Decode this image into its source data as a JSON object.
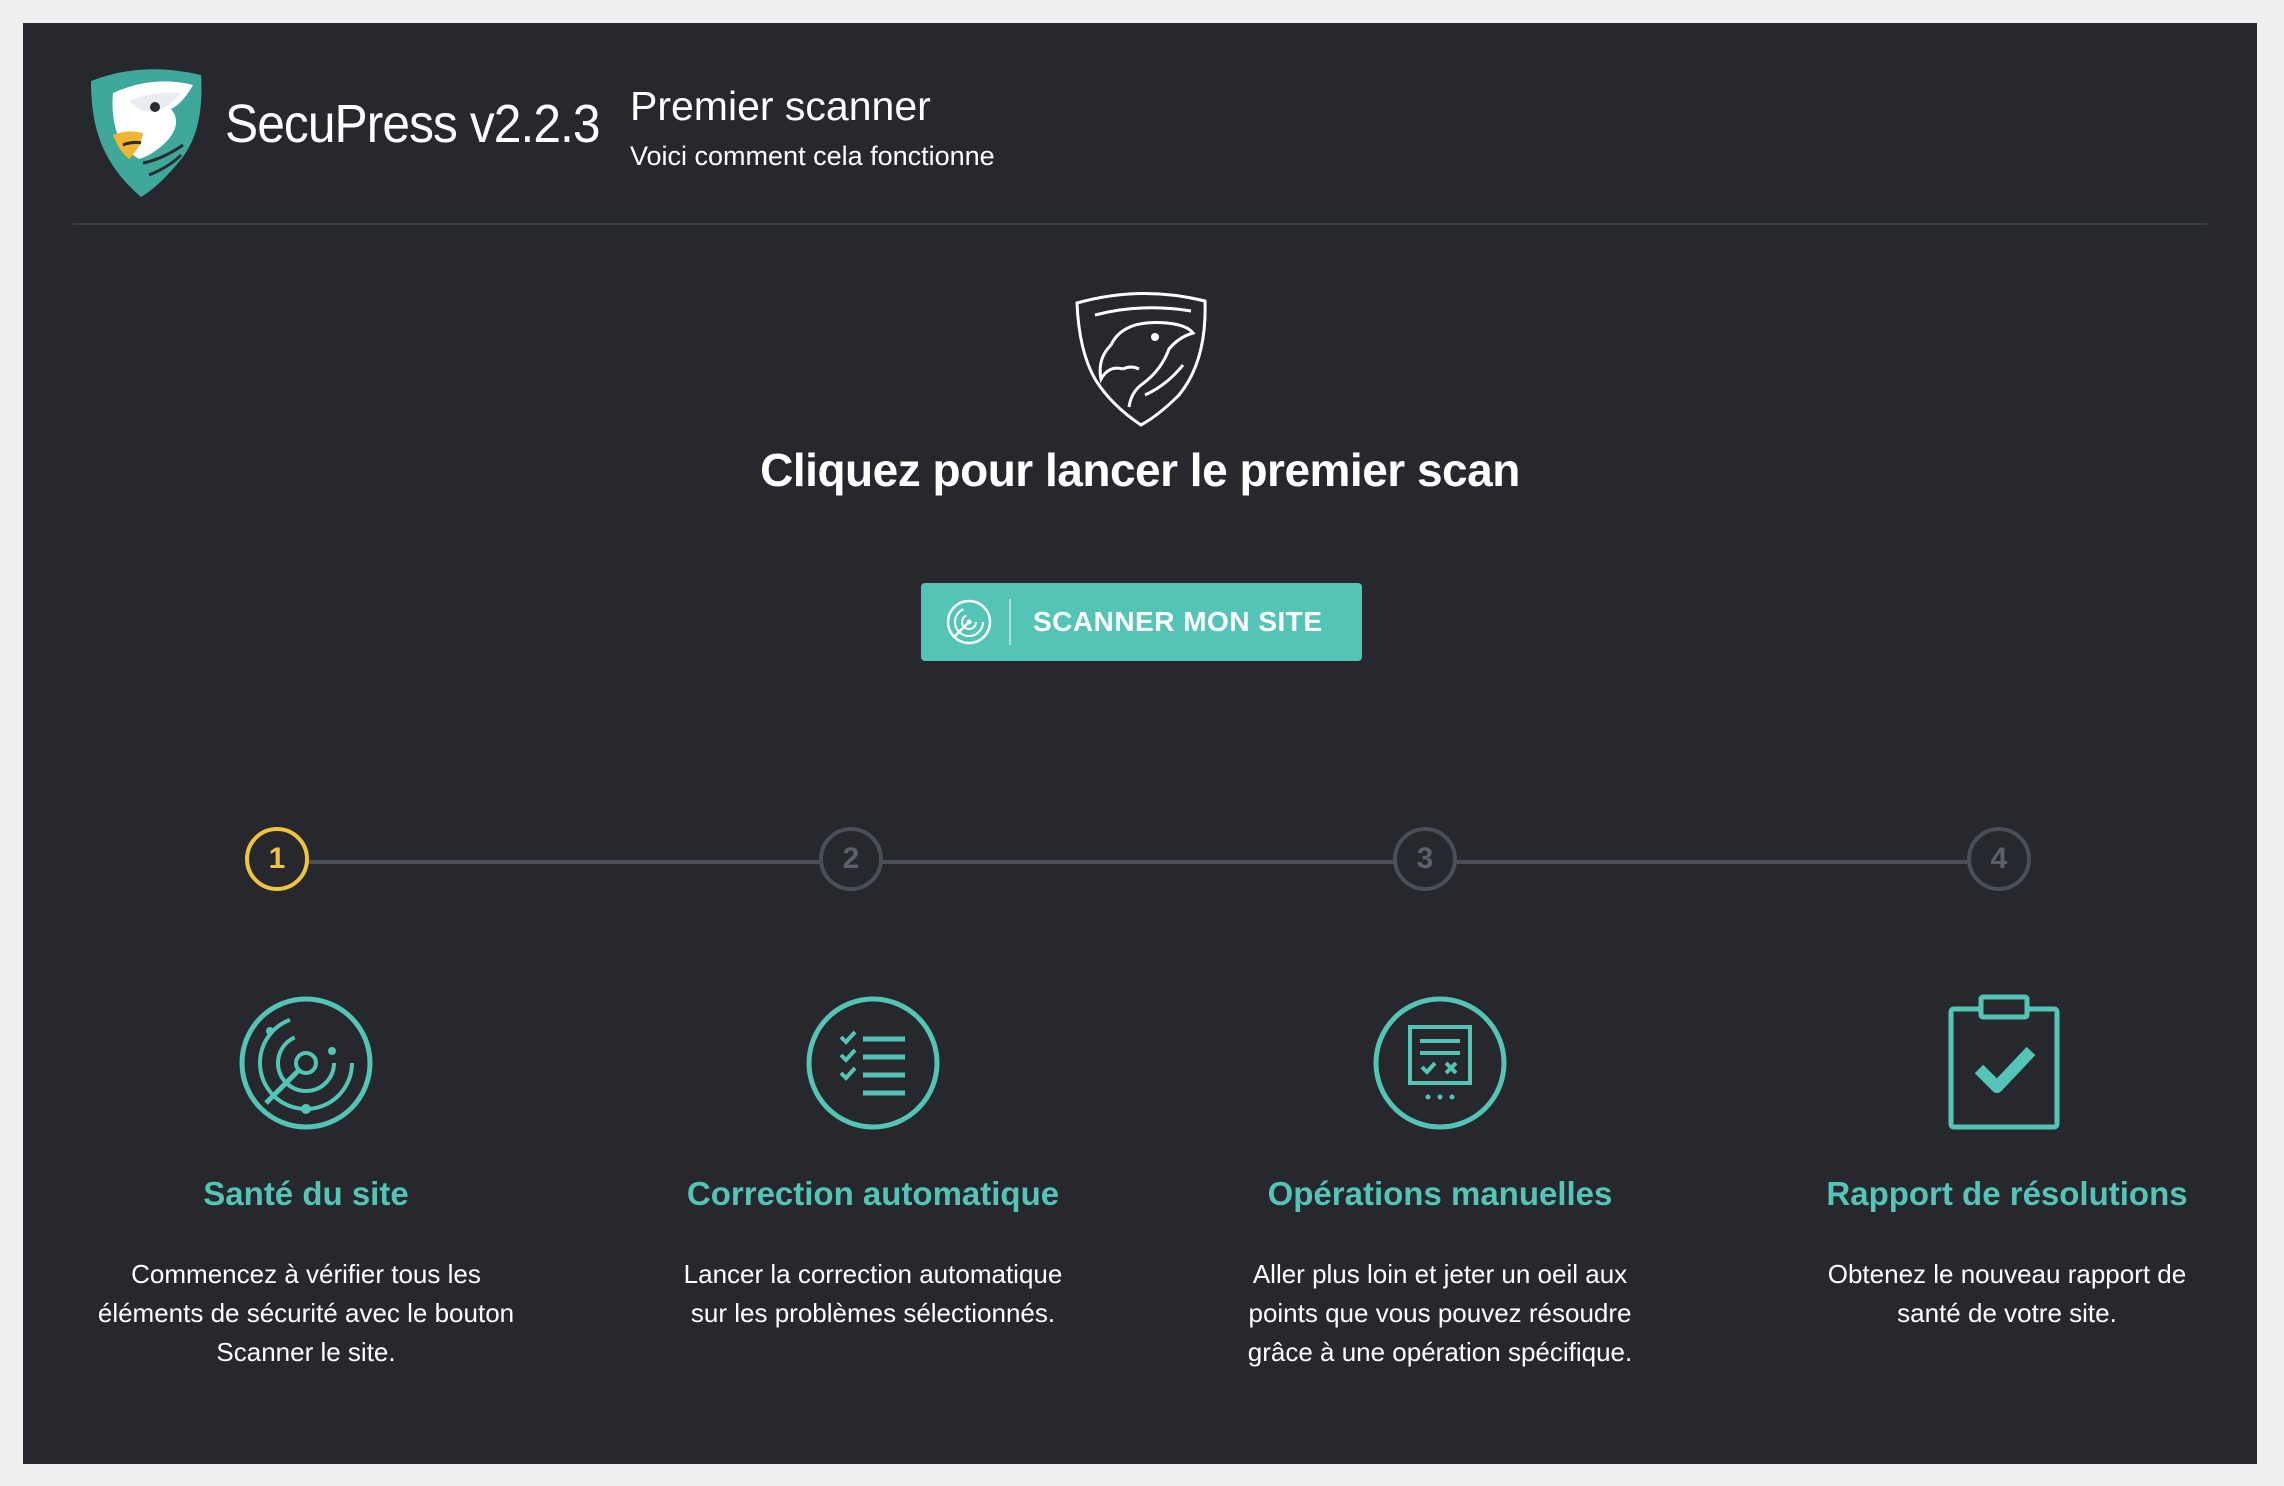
{
  "header": {
    "brand": "SecuPress v2.2.3",
    "title": "Premier scanner",
    "subtitle": "Voici comment cela fonctionne"
  },
  "hero": {
    "title": "Cliquez pour lancer le premier scan",
    "button_label": "SCANNER MON SITE"
  },
  "steps": [
    {
      "number": "1",
      "active": true,
      "title": "Santé du site",
      "description": "Commencez à vérifier tous les éléments de sécurité avec le bouton Scanner le site.",
      "icon": "radar-icon"
    },
    {
      "number": "2",
      "active": false,
      "title": "Correction automatique",
      "description": "Lancer la correction automatique sur les problèmes sélectionnés.",
      "icon": "checklist-icon"
    },
    {
      "number": "3",
      "active": false,
      "title": "Opérations manuelles",
      "description": "Aller plus loin et jeter un oeil aux points que vous pouvez résoudre grâce à une opération spécifique.",
      "icon": "manual-task-icon"
    },
    {
      "number": "4",
      "active": false,
      "title": "Rapport de résolutions",
      "description": "Obtenez le nouveau rapport de santé de votre site.",
      "icon": "clipboard-check-icon"
    }
  ],
  "colors": {
    "background": "#26282e",
    "accent": "#54c4b7",
    "active_step": "#f0c43c",
    "inactive_step": "#4a4e57"
  }
}
